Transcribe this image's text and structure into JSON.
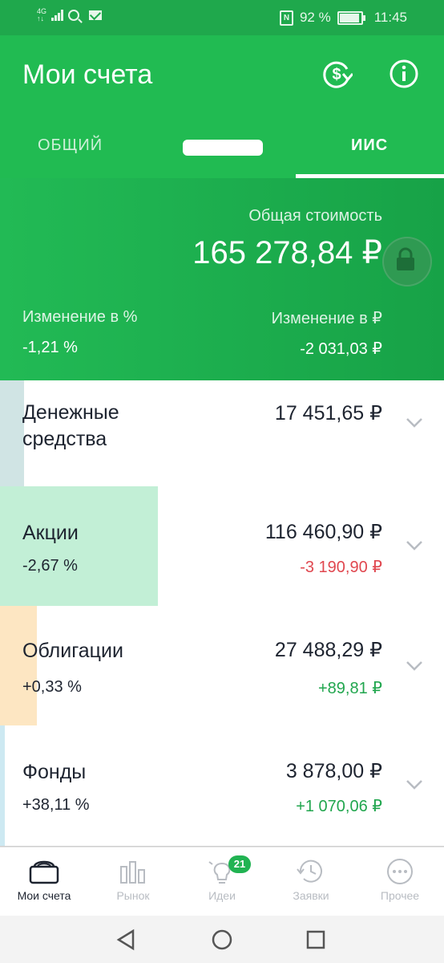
{
  "status_bar": {
    "net_type_top": "4G",
    "net_type_bottom": "↑↓",
    "battery_text": "92 %",
    "battery_fraction": 0.92,
    "time": "11:45",
    "nfc": "N"
  },
  "app_bar": {
    "title": "Мои счета",
    "exchange_icon": "currency-exchange-icon",
    "info_icon": "info-icon"
  },
  "tabs": {
    "general": "ОБЩИЙ",
    "iis": "ИИС",
    "active": "ИИС"
  },
  "summary": {
    "total_label": "Общая стоимость",
    "total_value": "165 278,84 ₽",
    "change_pct_label": "Изменение в  %",
    "change_pct_value": "-1,21  %",
    "change_rub_label": "Изменение в ₽",
    "change_rub_value": "-2 031,03 ₽"
  },
  "assets": [
    {
      "name_line1": "Денежные",
      "name_line2": "средства",
      "value": "17 451,65 ₽",
      "pct": "",
      "change": "",
      "share": 0.106,
      "bar_color": "#d0e4e4"
    },
    {
      "name_line1": "Акции",
      "name_line2": "",
      "value": "116 460,90 ₽",
      "pct": "-2,67  %",
      "change": "-3 190,90 ₽",
      "change_color": "#e0474f",
      "share": 0.705,
      "bar_color": "#c2efd6"
    },
    {
      "name_line1": "Облигации",
      "name_line2": "",
      "value": "27 488,29 ₽",
      "pct": "+0,33  %",
      "change": "+89,81 ₽",
      "change_color": "#21a64e",
      "share": 0.166,
      "bar_color": "#fde6c2"
    },
    {
      "name_line1": "Фонды",
      "name_line2": "",
      "value": "3 878,00 ₽",
      "pct": "+38,11  %",
      "change": "+1 070,06 ₽",
      "change_color": "#21a64e",
      "share": 0.023,
      "bar_color": "#cde9f2"
    }
  ],
  "bottom_nav": [
    {
      "label": "Мои счета",
      "icon": "wallet-icon",
      "active": true
    },
    {
      "label": "Рынок",
      "icon": "bar-chart-icon"
    },
    {
      "label": "Идеи",
      "icon": "lightbulb-icon",
      "badge": "21"
    },
    {
      "label": "Заявки",
      "icon": "history-clock-icon"
    },
    {
      "label": "Прочее",
      "icon": "more-dots-icon"
    }
  ],
  "system_nav": {
    "back_icon": "back-triangle-icon",
    "home_icon": "home-circle-icon",
    "recents_icon": "recents-square-icon"
  },
  "colors": {
    "primary": "#21bb52",
    "status_bar": "#1fa84c",
    "negative": "#e0474f",
    "positive": "#21a64e"
  }
}
